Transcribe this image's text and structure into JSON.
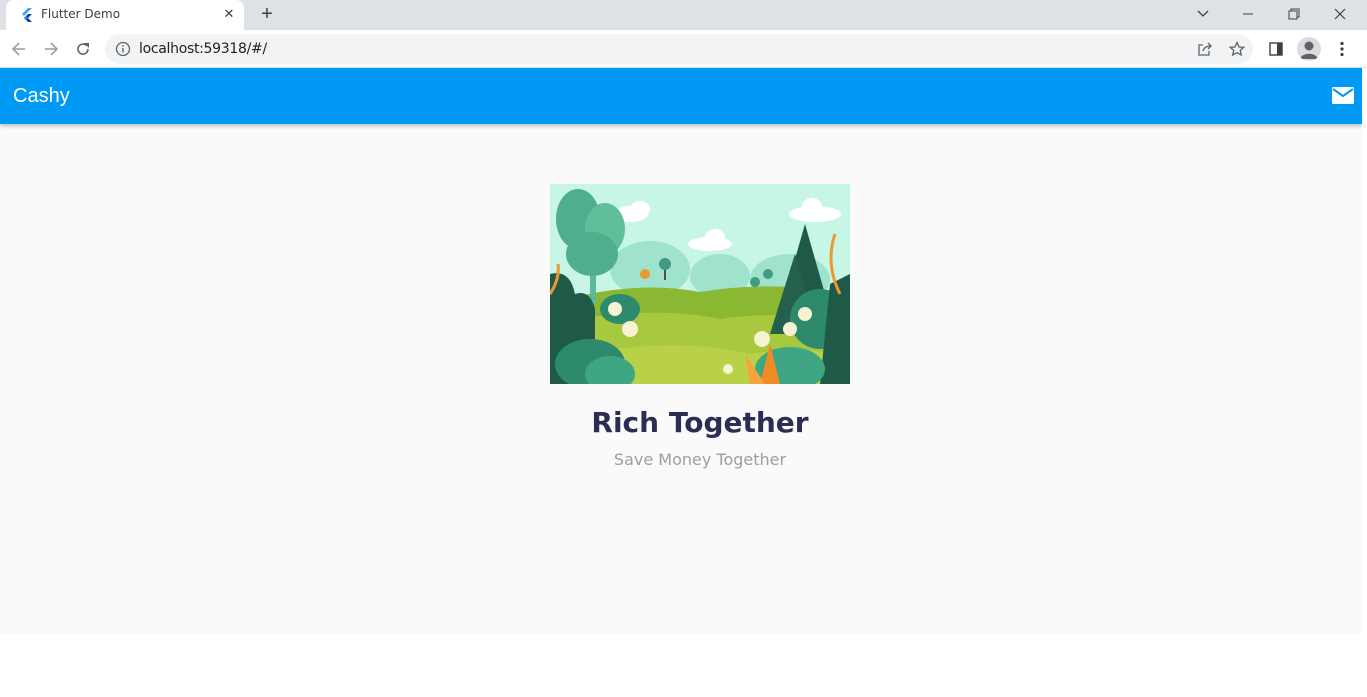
{
  "browser": {
    "tab": {
      "title": "Flutter Demo",
      "favicon": "flutter-logo-icon"
    },
    "address": {
      "url": "localhost:59318/#/"
    },
    "window_controls": [
      "tab-search-icon",
      "minimize-icon",
      "restore-icon",
      "close-icon"
    ],
    "toolbar_icons": [
      "back-icon",
      "forward-icon",
      "reload-icon",
      "share-icon",
      "bookmark-star-icon",
      "side-panel-icon",
      "profile-icon",
      "menu-icon"
    ]
  },
  "app": {
    "appbar": {
      "title": "Cashy",
      "action_icon": "mail-icon"
    },
    "hero": {
      "title": "Rich Together",
      "subtitle": "Save Money Together"
    }
  },
  "colors": {
    "appbar": "#0099f3",
    "title_text": "#2b2d52",
    "subtitle_text": "#9e9e9e",
    "background": "#fafafa"
  }
}
